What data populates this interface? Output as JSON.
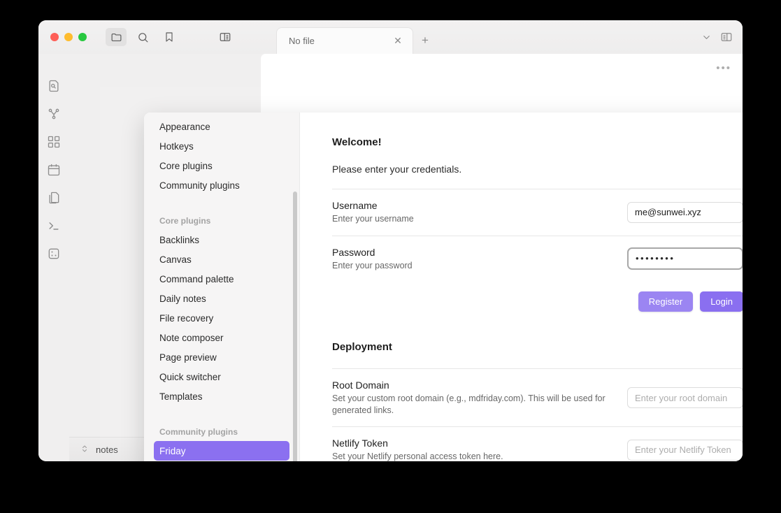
{
  "window": {
    "traffic_lights": [
      "close",
      "minimize",
      "zoom"
    ],
    "toolbar_icons": [
      "folder-icon",
      "search-icon",
      "bookmark-icon",
      "left-sidebar-toggle-icon"
    ],
    "toolbar_right_icons": [
      "chevron-down-icon",
      "right-sidebar-toggle-icon"
    ]
  },
  "tab": {
    "title": "No file",
    "close_label": "✕",
    "new_tab_label": "+"
  },
  "ribbon": {
    "items": [
      {
        "name": "file-search-icon"
      },
      {
        "name": "graph-view-icon"
      },
      {
        "name": "canvas-grid-icon"
      },
      {
        "name": "calendar-icon"
      },
      {
        "name": "copy-files-icon"
      },
      {
        "name": "terminal-icon"
      },
      {
        "name": "dice-icon"
      }
    ]
  },
  "editor": {
    "more_options_label": "•••"
  },
  "statusbar": {
    "vault_name": "notes",
    "vault_switcher_icon": "updown-chevrons-icon",
    "help_label": "?",
    "settings_icon": "gear-icon"
  },
  "settings": {
    "close_label": "✕",
    "nav": [
      {
        "type": "item",
        "label": "Appearance",
        "selected": false
      },
      {
        "type": "item",
        "label": "Hotkeys",
        "selected": false
      },
      {
        "type": "item",
        "label": "Core plugins",
        "selected": false
      },
      {
        "type": "item",
        "label": "Community plugins",
        "selected": false
      },
      {
        "type": "space"
      },
      {
        "type": "head",
        "label": "Core plugins"
      },
      {
        "type": "item",
        "label": "Backlinks",
        "selected": false
      },
      {
        "type": "item",
        "label": "Canvas",
        "selected": false
      },
      {
        "type": "item",
        "label": "Command palette",
        "selected": false
      },
      {
        "type": "item",
        "label": "Daily notes",
        "selected": false
      },
      {
        "type": "item",
        "label": "File recovery",
        "selected": false
      },
      {
        "type": "item",
        "label": "Note composer",
        "selected": false
      },
      {
        "type": "item",
        "label": "Page preview",
        "selected": false
      },
      {
        "type": "item",
        "label": "Quick switcher",
        "selected": false
      },
      {
        "type": "item",
        "label": "Templates",
        "selected": false
      },
      {
        "type": "space"
      },
      {
        "type": "head",
        "label": "Community plugins"
      },
      {
        "type": "item",
        "label": "Friday",
        "selected": true
      }
    ],
    "content": {
      "welcome_title": "Welcome!",
      "welcome_subtitle": "Please enter your credentials.",
      "username": {
        "name": "Username",
        "desc": "Enter your username",
        "value": "me@sunwei.xyz",
        "placeholder": "Enter your username"
      },
      "password": {
        "name": "Password",
        "desc": "Enter your password",
        "value": "••••••••",
        "placeholder": "Enter your password"
      },
      "register_label": "Register",
      "login_label": "Login",
      "deployment_title": "Deployment",
      "root_domain": {
        "name": "Root Domain",
        "desc": "Set your custom root domain (e.g., mdfriday.com). This will be used for generated links.",
        "value": "",
        "placeholder": "Enter your root domain"
      },
      "netlify_token": {
        "name": "Netlify Token",
        "desc": "Set your Netlify personal access token here.",
        "value": "",
        "placeholder": "Enter your Netlify Token"
      }
    }
  },
  "colors": {
    "accent": "#8a6ff0",
    "accent_light": "#9b85f2",
    "selected_nav": "#8b70f0"
  }
}
